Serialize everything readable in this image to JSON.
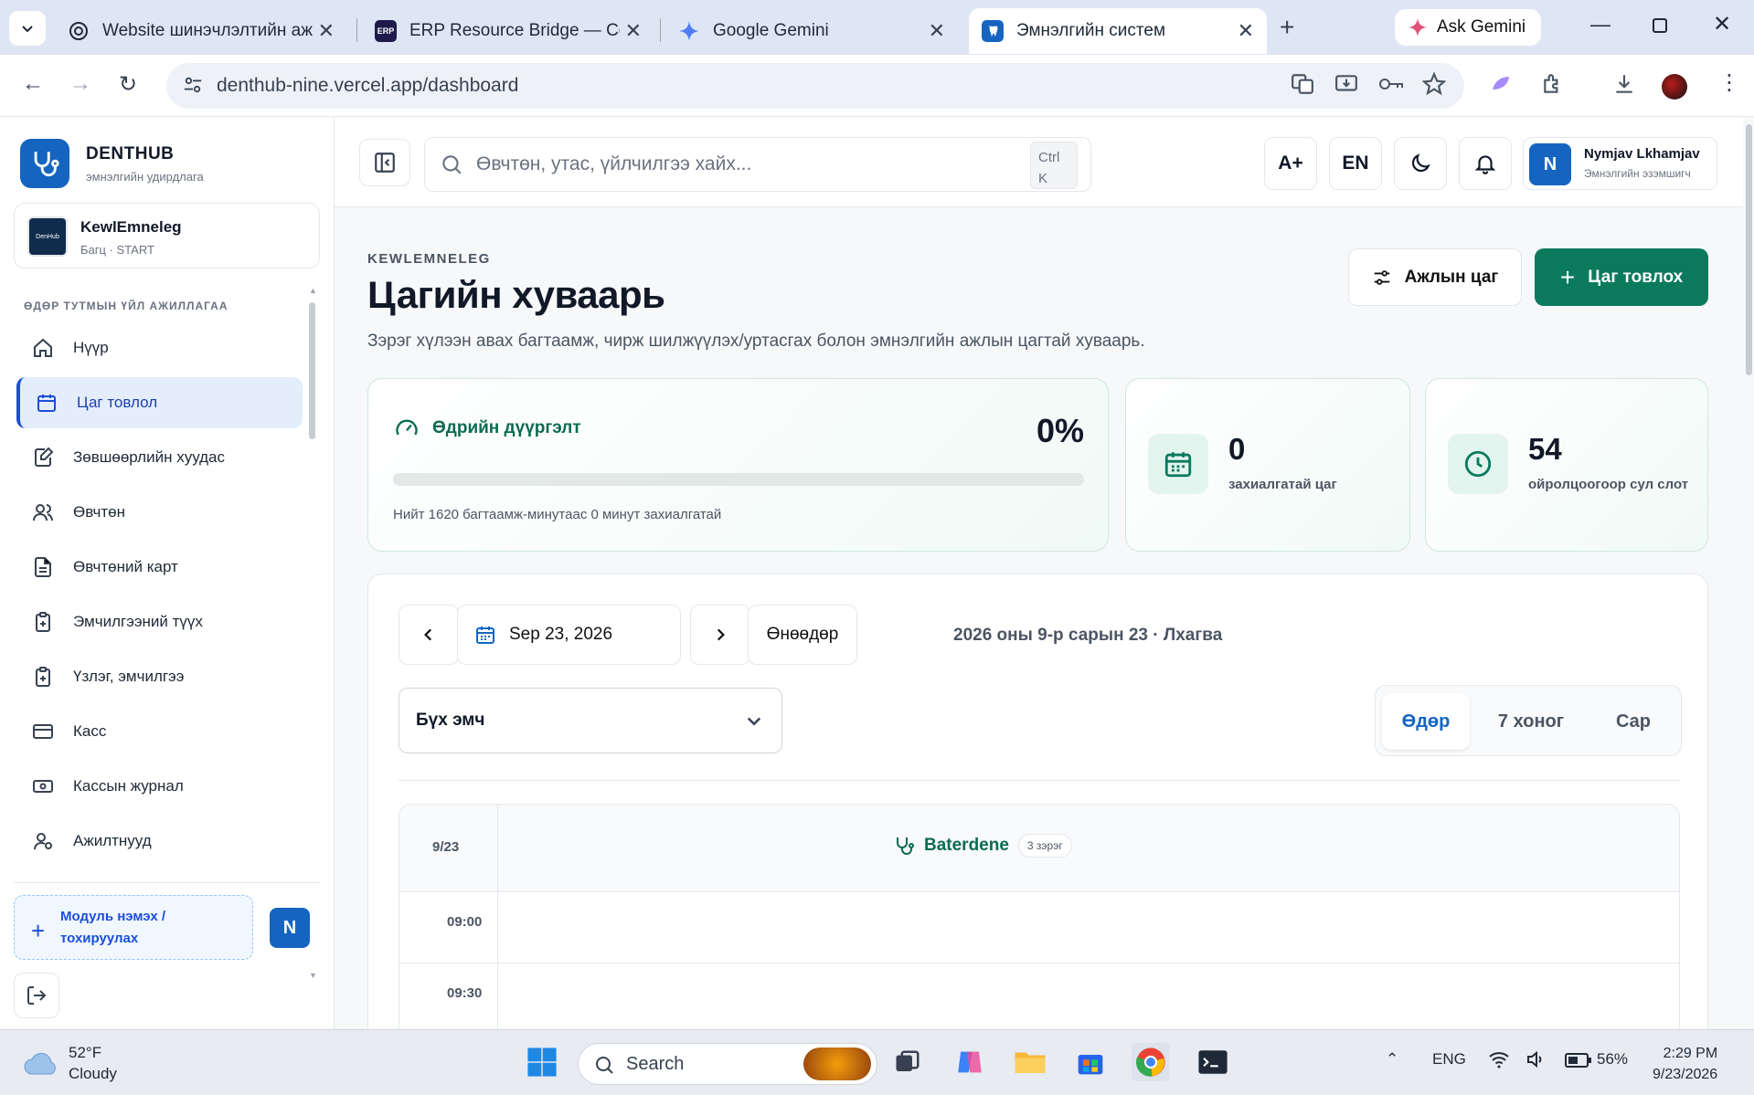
{
  "browser": {
    "tabs": [
      {
        "title": "Website шинэчлэлтийн ажи",
        "icon": "openai-icon",
        "active": false
      },
      {
        "title": "ERP Resource Bridge — Con",
        "icon": "erp-icon",
        "active": false
      },
      {
        "title": "Google Gemini",
        "icon": "gemini-icon",
        "active": false
      },
      {
        "title": "Эмнэлгийн систем",
        "icon": "denthub-icon",
        "active": true
      }
    ],
    "ask_gemini": "Ask Gemini",
    "url": "denthub-nine.vercel.app/dashboard"
  },
  "sidebar": {
    "brand": "DENTHUB",
    "brand_sub": "эмнэлгийн удирдлага",
    "clinic_name": "KewlEmneleg",
    "clinic_plan": "Багц · START",
    "clinic_logo_text": "DenHub",
    "section_title": "ӨДӨР ТУТМЫН ҮЙЛ АЖИЛЛАГАА",
    "items": [
      {
        "label": "Нүүр",
        "icon": "home-icon",
        "active": false
      },
      {
        "label": "Цаг товлол",
        "icon": "calendar-icon",
        "active": true
      },
      {
        "label": "Зөвшөөрлийн хуудас",
        "icon": "consent-edit-icon",
        "active": false
      },
      {
        "label": "Өвчтөн",
        "icon": "patients-icon",
        "active": false
      },
      {
        "label": "Өвчтөний карт",
        "icon": "patient-card-icon",
        "active": false
      },
      {
        "label": "Эмчилгээний түүх",
        "icon": "treatment-history-icon",
        "active": false
      },
      {
        "label": "Үзлэг, эмчилгээ",
        "icon": "examination-icon",
        "active": false
      },
      {
        "label": "Касс",
        "icon": "card-icon",
        "active": false
      },
      {
        "label": "Кассын журнал",
        "icon": "cash-journal-icon",
        "active": false
      },
      {
        "label": "Ажилтнууд",
        "icon": "staff-icon",
        "active": false
      }
    ],
    "add_module_line1": "Модуль нэмэх /",
    "add_module_line2": "тохируулах",
    "user_initial": "N"
  },
  "topbar": {
    "search_placeholder": "Өвчтөн, утас, үйлчилгээ хайх...",
    "kbd_line1": "Ctrl",
    "kbd_line2": "K",
    "font_size_label": "A+",
    "lang_label": "EN",
    "user_initial": "N",
    "user_name": "Nymjav Lkhamjav",
    "user_role": "Эмнэлгийн эзэмшигч"
  },
  "page": {
    "eyebrow": "KEWLEMNELEG",
    "title": "Цагийн хуваарь",
    "description": "Зэрэг хүлээн авах багтаамж, чирж шилжүүлэх/уртасгах болон эмнэлгийн ажлын цагтай хуваарь.",
    "work_hours_button": "Ажлын цаг",
    "book_button": "Цаг товлох"
  },
  "stats": {
    "completion_title": "Өдрийн дүүргэлт",
    "completion_pct_label": "0%",
    "completion_value": 0,
    "completion_note": "Нийт 1620 багтаамж-минутаас 0 минут захиалгатай",
    "booked_value": "0",
    "booked_label": "захиалгатай цаг",
    "free_value": "54",
    "free_label": "ойролцоогоор сул слот"
  },
  "schedule": {
    "date_value": "Sep 23, 2026",
    "today_button": "Өнөөдөр",
    "date_long": "2026 оны 9-р сарын 23 · Лхагва",
    "doctor_select": "Бүх эмч",
    "views": [
      "Өдөр",
      "7 хоног",
      "Сар"
    ],
    "active_view": "Өдөр",
    "grid_date": "9/23",
    "doctor_name": "Baterdene",
    "doctor_capacity": "3 зэрэг",
    "times": [
      "09:00",
      "09:30"
    ]
  },
  "taskbar": {
    "temp": "52°F",
    "condition": "Cloudy",
    "search_placeholder": "Search",
    "lang": "ENG",
    "battery": "56%",
    "time": "2:29 PM",
    "date": "9/23/2026"
  }
}
